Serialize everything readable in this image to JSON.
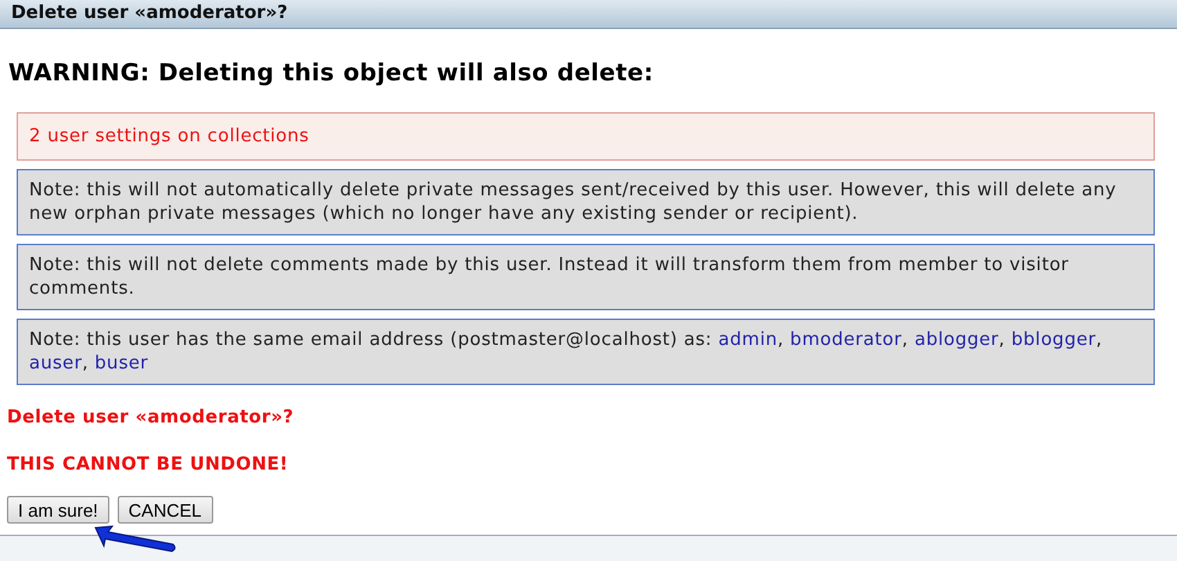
{
  "window": {
    "title": "Delete user «amoderator»?"
  },
  "warning": "WARNING: Deleting this object will also delete:",
  "error_items": [
    "2 user settings on collections"
  ],
  "notes": [
    {
      "parts": [
        {
          "kind": "text",
          "text": "Note: this will not automatically delete private messages sent/received by this user. However, this will delete any new orphan private messages (which no longer have any existing sender or recipient)."
        }
      ]
    },
    {
      "parts": [
        {
          "kind": "text",
          "text": "Note: this will not delete comments made by this user. Instead it will transform them from member to visitor comments."
        }
      ]
    },
    {
      "parts": [
        {
          "kind": "text",
          "text": "Note: this user has the same email address (postmaster@localhost) as: "
        },
        {
          "kind": "link",
          "text": "admin"
        },
        {
          "kind": "text",
          "text": ", "
        },
        {
          "kind": "link",
          "text": "bmoderator"
        },
        {
          "kind": "text",
          "text": ", "
        },
        {
          "kind": "link",
          "text": "ablogger"
        },
        {
          "kind": "text",
          "text": ", "
        },
        {
          "kind": "link",
          "text": "bblogger"
        },
        {
          "kind": "text",
          "text": ", "
        },
        {
          "kind": "link",
          "text": "auser"
        },
        {
          "kind": "text",
          "text": ", "
        },
        {
          "kind": "link",
          "text": "buser"
        }
      ]
    }
  ],
  "confirm_question": "Delete user «amoderator»?",
  "confirm_warning": "THIS CANNOT BE UNDONE!",
  "buttons": [
    "I am sure!",
    "CANCEL"
  ]
}
